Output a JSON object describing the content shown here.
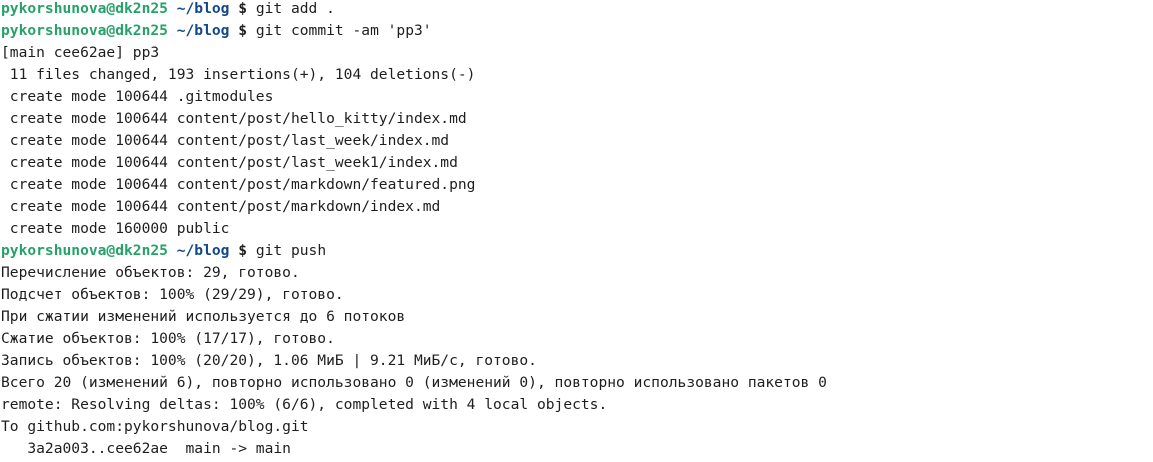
{
  "colors": {
    "background": "#ffffff",
    "text": "#1e1e1e",
    "prompt_user": "#26a269",
    "prompt_path": "#12488b"
  },
  "prompt": {
    "user_host": "pykorshunova@dk2n25",
    "path": "~/blog",
    "sign": "$"
  },
  "lines": [
    {
      "type": "command",
      "text": "git add ."
    },
    {
      "type": "command",
      "text": "git commit -am 'pp3'"
    },
    {
      "type": "output",
      "text": "[main cee62ae] pp3"
    },
    {
      "type": "output",
      "text": " 11 files changed, 193 insertions(+), 104 deletions(-)"
    },
    {
      "type": "output",
      "text": " create mode 100644 .gitmodules"
    },
    {
      "type": "output",
      "text": " create mode 100644 content/post/hello_kitty/index.md"
    },
    {
      "type": "output",
      "text": " create mode 100644 content/post/last_week/index.md"
    },
    {
      "type": "output",
      "text": " create mode 100644 content/post/last_week1/index.md"
    },
    {
      "type": "output",
      "text": " create mode 100644 content/post/markdown/featured.png"
    },
    {
      "type": "output",
      "text": " create mode 100644 content/post/markdown/index.md"
    },
    {
      "type": "output",
      "text": " create mode 160000 public"
    },
    {
      "type": "command",
      "text": "git push"
    },
    {
      "type": "output",
      "text": "Перечисление объектов: 29, готово."
    },
    {
      "type": "output",
      "text": "Подсчет объектов: 100% (29/29), готово."
    },
    {
      "type": "output",
      "text": "При сжатии изменений используется до 6 потоков"
    },
    {
      "type": "output",
      "text": "Сжатие объектов: 100% (17/17), готово."
    },
    {
      "type": "output",
      "text": "Запись объектов: 100% (20/20), 1.06 МиБ | 9.21 МиБ/с, готово."
    },
    {
      "type": "output",
      "text": "Всего 20 (изменений 6), повторно использовано 0 (изменений 0), повторно использовано пакетов 0"
    },
    {
      "type": "output",
      "text": "remote: Resolving deltas: 100% (6/6), completed with 4 local objects."
    },
    {
      "type": "output",
      "text": "To github.com:pykorshunova/blog.git"
    },
    {
      "type": "output",
      "text": "   3a2a003..cee62ae  main -> main"
    }
  ]
}
